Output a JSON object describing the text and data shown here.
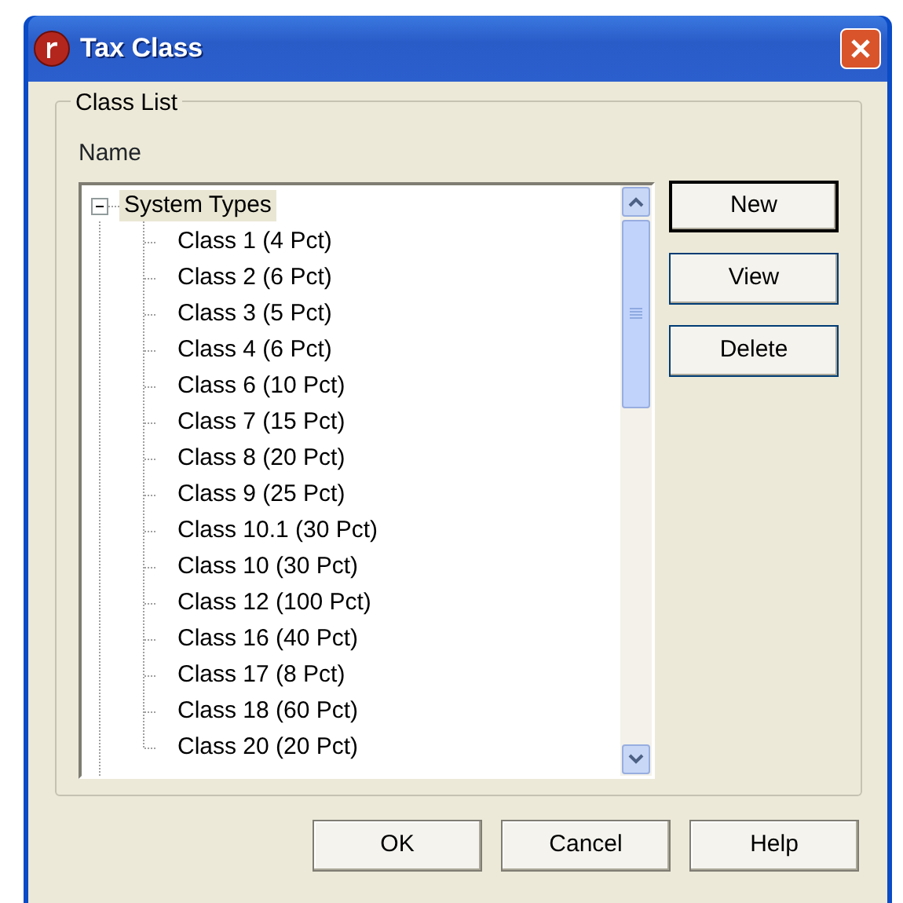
{
  "window": {
    "title": "Tax Class"
  },
  "group": {
    "title": "Class List",
    "field_label": "Name"
  },
  "tree": [
    {
      "label": "System Types",
      "expanded": true,
      "selected": true,
      "children": [
        {
          "label": "Class 1 (4 Pct)",
          "selected": false
        },
        {
          "label": "Class 2 (6 Pct)",
          "selected": false
        },
        {
          "label": "Class 3 (5 Pct)",
          "selected": false
        },
        {
          "label": "Class 4 (6 Pct)",
          "selected": false
        },
        {
          "label": "Class 6 (10 Pct)",
          "selected": false
        },
        {
          "label": "Class 7 (15 Pct)",
          "selected": false
        },
        {
          "label": "Class 8 (20 Pct)",
          "selected": false
        },
        {
          "label": "Class 9 (25 Pct)",
          "selected": false
        },
        {
          "label": "Class 10.1 (30 Pct)",
          "selected": false
        },
        {
          "label": "Class 10 (30 Pct)",
          "selected": false
        },
        {
          "label": "Class 12 (100 Pct)",
          "selected": false
        },
        {
          "label": "Class 16 (40 Pct)",
          "selected": false
        },
        {
          "label": "Class 17 (8 Pct)",
          "selected": false
        },
        {
          "label": "Class 18 (60 Pct)",
          "selected": false
        },
        {
          "label": "Class 20 (20 Pct)",
          "selected": false
        }
      ]
    }
  ],
  "side_buttons": [
    {
      "label": "New",
      "default": true
    },
    {
      "label": "View",
      "default": false
    },
    {
      "label": "Delete",
      "default": false
    }
  ],
  "buttons": [
    "OK",
    "Cancel",
    "Help"
  ]
}
